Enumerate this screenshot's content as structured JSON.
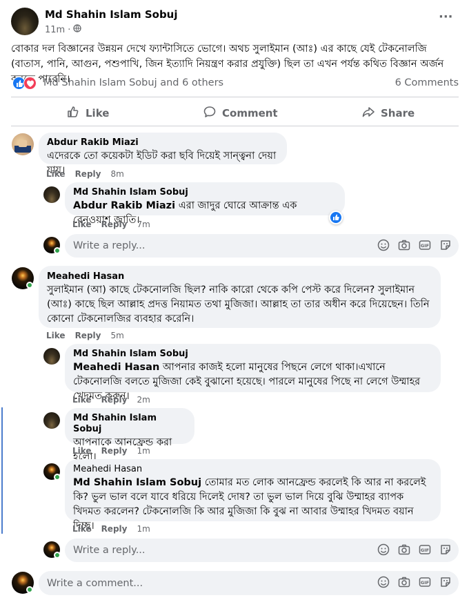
{
  "post": {
    "author": "Md Shahin Islam Sobuj",
    "time": "11m",
    "privacy_dot": "·",
    "more": "···",
    "text": "বোকার দল বিজ্ঞানের উন্নয়ন দেখে ফ্যান্টাসিতে ভোগে। অথচ সুলাইমান (আঃ) এর কাছে যেই টেকনোলজি (বাতাস, পানি, আগুন, পশুপাখি, জিন ইত্যাদি নিয়ন্ত্রণ করার প্রযুক্তি) ছিল তা এখন পর্যন্ত কথিত বিজ্ঞান অর্জন করতে পারেনি।",
    "reactions_text": "Md Shahin Islam Sobuj and 6 others",
    "comments_count": "6 Comments"
  },
  "buttons": {
    "like": "Like",
    "comment": "Comment",
    "share": "Share"
  },
  "comments": [
    {
      "name": "Abdur Rakib Miazi",
      "text": "এদেরকে তো কয়েকটা ইডিট করা ছবি দিয়েই সান্ত্বনা দেয়া যায়।",
      "like": "Like",
      "reply": "Reply",
      "time": "8m",
      "replies": [
        {
          "name": "Md Shahin Islam Sobuj",
          "mention": "Abdur Rakib Miazi",
          "text": " এরা জাদুর ঘোরে আক্রান্ত এক রেনওয়াশ জাতি।",
          "like": "Like",
          "reply": "Reply",
          "time": "7m"
        }
      ],
      "reply_placeholder": "Write a reply..."
    },
    {
      "name": "Meahedi Hasan",
      "text": "সুলাইমান (আ) কাছে টেকনোলজি ছিল? নাকি কারো থেকে কপি পেস্ট করে দিলেন? সুলাইমান (আঃ) কাছে ছিল আল্লাহ প্রদত্ত নিয়ামত তথা মুজিজা। আল্লাহ তা তার অধীন করে দিয়েছেন। তিনি কোনো টেকনোলজির ব্যবহার করেনি।",
      "like": "Like",
      "reply": "Reply",
      "time": "5m",
      "replies": [
        {
          "name": "Md Shahin Islam Sobuj",
          "mention": "Meahedi Hasan",
          "text": " আপনার কাজই হলো মানুষের পিছনে লেগে থাকা।এখানে টেকনোলজি বলতে মুজিজা কেই বুঝানো হয়েছে। পারলে মানুষের পিছে না লেগে উম্মাহর খেদমত করুন।",
          "like": "Like",
          "reply": "Reply",
          "time": "2m"
        },
        {
          "name": "Md Shahin Islam Sobuj",
          "mention": "",
          "text": "আপনাকে আনফ্রেন্ড করা হলো।",
          "like": "Like",
          "reply": "Reply",
          "time": "1m"
        },
        {
          "name": "Meahedi Hasan",
          "mention": "Md Shahin Islam Sobuj",
          "text": " তোমার মত লোক আনফ্রেন্ড করলেই কি আর না করলেই কি? ভুল ভাল বলে যাবে ধরিয়ে দিলেই দোষ? তা ভুল ভাল দিয়ে বুঝি উম্মাহর ব্যাপক খিদমত করলেন? টেকনোলজি কি আর মুজিজা কি বুঝ না আবার উম্মাহর খিদমত বয়ান দিচ্ছ।",
          "like": "Like",
          "reply": "Reply",
          "time": "1m"
        }
      ],
      "reply_placeholder": "Write a reply..."
    }
  ],
  "comment_placeholder": "Write a comment...",
  "colors": {
    "like_blue": "#1877f2",
    "love_red": "#f33e58",
    "online_green": "#31a24c"
  },
  "icons": [
    "globe-icon",
    "more-icon",
    "like-icon",
    "love-icon",
    "thumbs-up-icon",
    "comment-icon",
    "share-icon",
    "emoji-icon",
    "camera-icon",
    "gif-icon",
    "sticker-icon"
  ]
}
